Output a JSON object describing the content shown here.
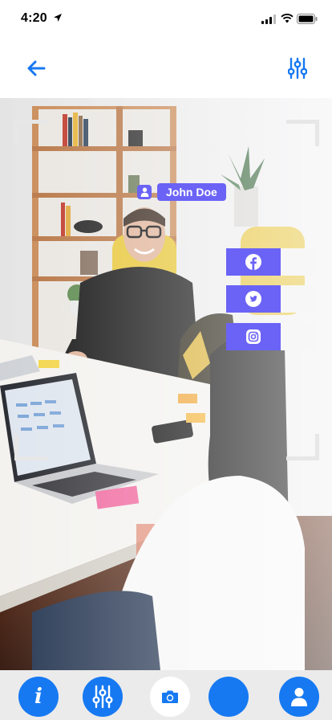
{
  "status_bar": {
    "time": "4:20",
    "icons": [
      "location-arrow-icon",
      "cellular-signal-icon",
      "wifi-icon",
      "battery-icon"
    ]
  },
  "header": {
    "back_icon": "arrow-left-icon",
    "filter_icon": "sliders-icon",
    "accent_color": "#1679f2"
  },
  "photo": {
    "description_icon": "user-icon",
    "name_tag": "John Doe",
    "tag_color": "#6b63f6",
    "social_links": [
      {
        "network": "facebook",
        "icon": "facebook-icon"
      },
      {
        "network": "twitter",
        "icon": "twitter-icon"
      },
      {
        "network": "instagram",
        "icon": "instagram-icon"
      }
    ]
  },
  "bottom_bar": {
    "buttons": [
      {
        "id": "info",
        "icon": "info-icon"
      },
      {
        "id": "settings",
        "icon": "sliders-icon"
      },
      {
        "id": "camera",
        "icon": "camera-icon",
        "active": true
      },
      {
        "id": "blank",
        "icon": ""
      },
      {
        "id": "profile",
        "icon": "user-icon"
      }
    ],
    "accent_color": "#1679f2",
    "background": "#ebebeb"
  }
}
